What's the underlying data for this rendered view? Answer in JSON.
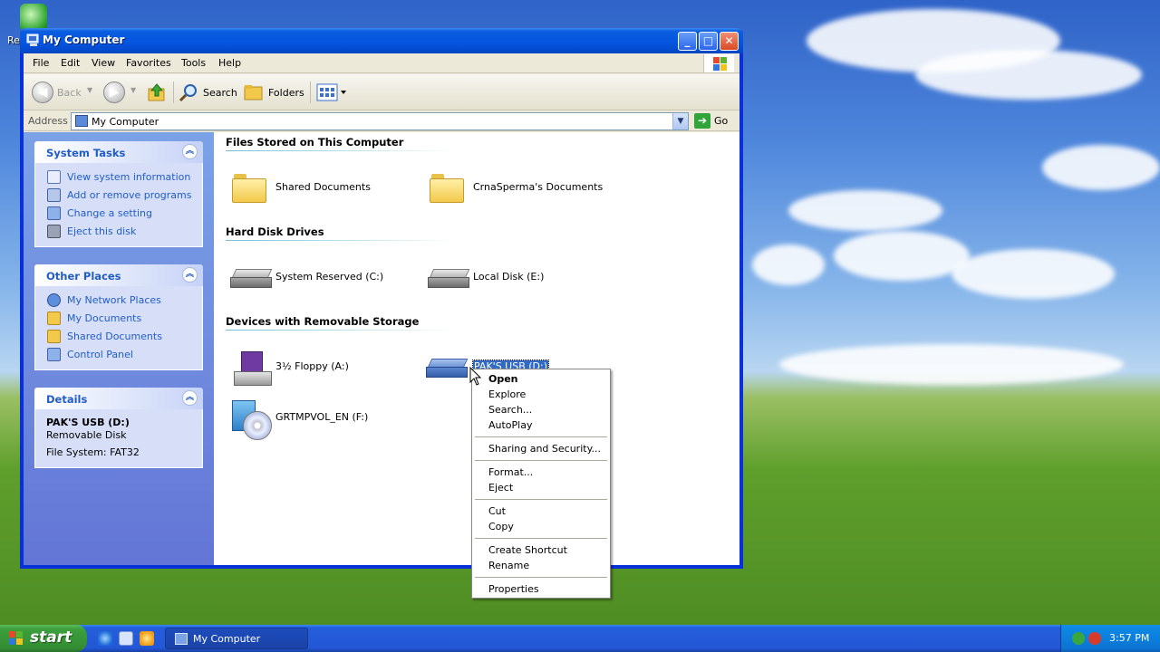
{
  "desktop": {
    "icon_label": "Re"
  },
  "window": {
    "title": "My Computer",
    "buttons": {
      "minimize": "_",
      "maximize": "□",
      "close": "✕"
    }
  },
  "menubar": [
    "File",
    "Edit",
    "View",
    "Favorites",
    "Tools",
    "Help"
  ],
  "toolbar": {
    "back": "Back",
    "search": "Search",
    "folders": "Folders"
  },
  "address": {
    "label": "Address",
    "value": "My Computer",
    "go": "Go"
  },
  "sidebar": {
    "system_tasks": {
      "title": "System Tasks",
      "items": [
        "View system information",
        "Add or remove programs",
        "Change a setting",
        "Eject this disk"
      ]
    },
    "other_places": {
      "title": "Other Places",
      "items": [
        "My Network Places",
        "My Documents",
        "Shared Documents",
        "Control Panel"
      ]
    },
    "details": {
      "title": "Details",
      "name": "PAK'S USB (D:)",
      "type": "Removable Disk",
      "fs": "File System: FAT32"
    }
  },
  "groups": {
    "files": {
      "title": "Files Stored on This Computer",
      "items": [
        "Shared Documents",
        "CrnaSperma's Documents"
      ]
    },
    "hdd": {
      "title": "Hard Disk Drives",
      "items": [
        "System Reserved (C:)",
        "Local Disk (E:)"
      ]
    },
    "removable": {
      "title": "Devices with Removable Storage",
      "items": [
        "3½ Floppy (A:)",
        "PAK'S USB (D:)",
        "GRTMPVOL_EN (F:)"
      ]
    }
  },
  "context_menu": {
    "open": "Open",
    "explore": "Explore",
    "search": "Search...",
    "autoplay": "AutoPlay",
    "sharing": "Sharing and Security...",
    "format": "Format...",
    "eject": "Eject",
    "cut": "Cut",
    "copy": "Copy",
    "create_shortcut": "Create Shortcut",
    "rename": "Rename",
    "properties": "Properties"
  },
  "taskbar": {
    "start": "start",
    "task": "My Computer",
    "clock": "3:57 PM"
  },
  "colors": {
    "accent": "#316ac5",
    "task_link": "#215dc6",
    "sidebar_top": "#7ba2e7"
  }
}
